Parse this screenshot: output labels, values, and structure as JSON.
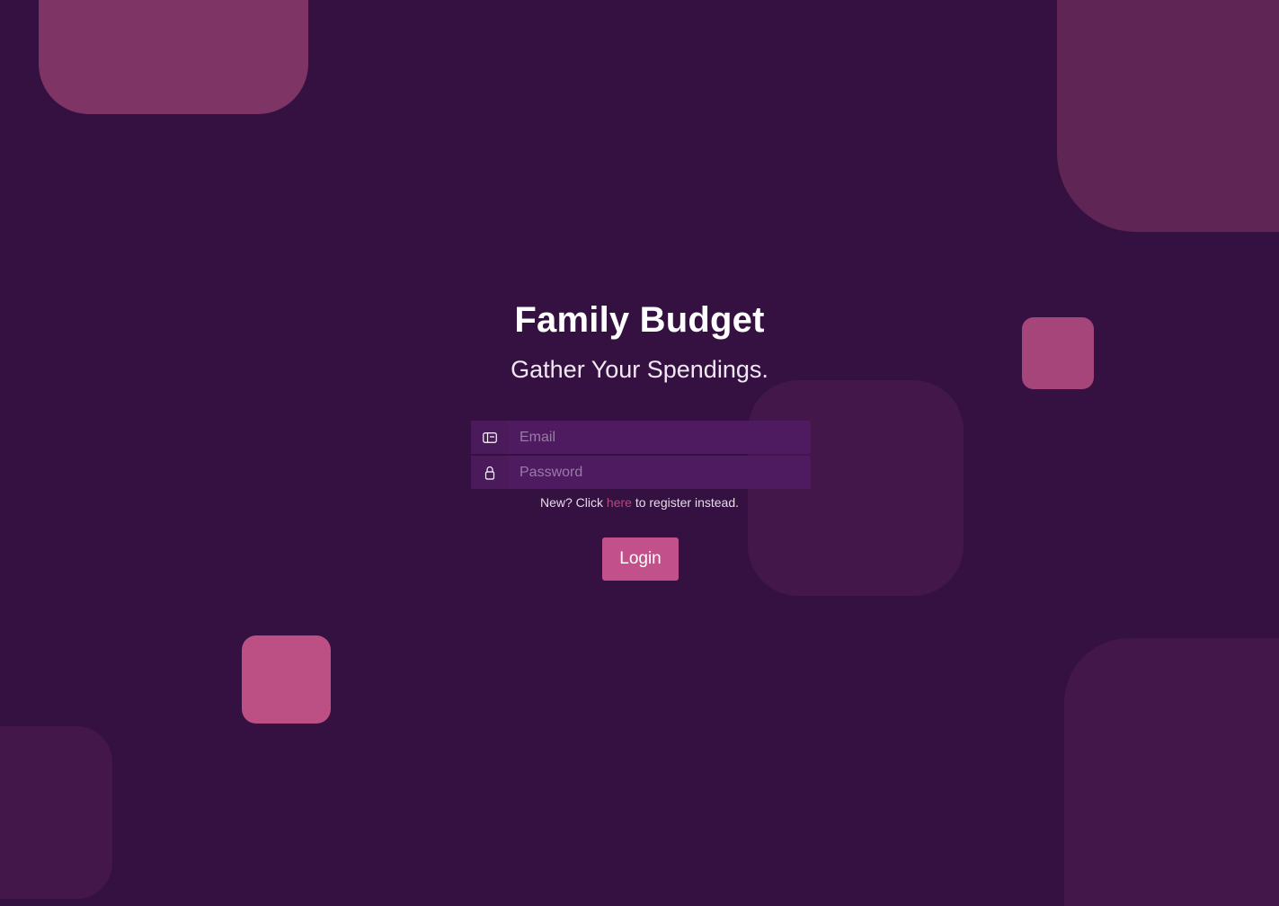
{
  "app": {
    "title": "Family Budget",
    "subtitle": "Gather Your Spendings."
  },
  "form": {
    "email": {
      "placeholder": "Email",
      "icon": "id-card-icon"
    },
    "password": {
      "placeholder": "Password",
      "icon": "lock-icon"
    },
    "register_prefix": "New? Click ",
    "register_link": "here",
    "register_suffix": " to register instead.",
    "login_label": "Login"
  },
  "colors": {
    "background": "#351142",
    "accent": "#c2508a",
    "input_bg": "#4e1b61",
    "link": "#b24a80"
  }
}
